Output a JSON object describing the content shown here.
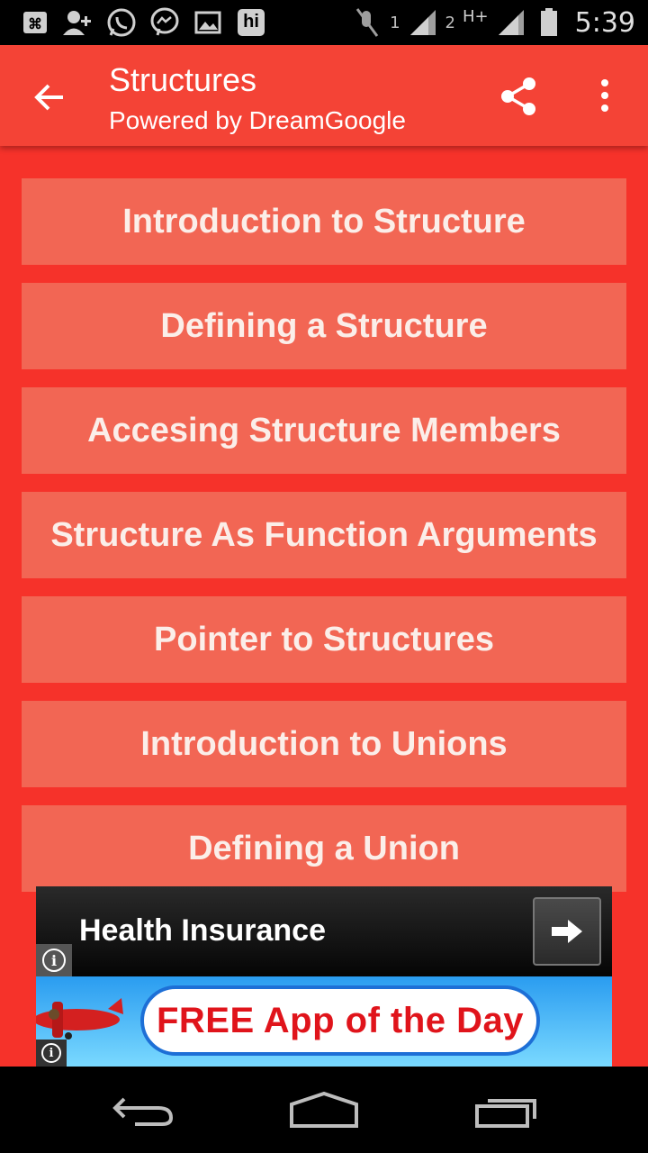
{
  "status_bar": {
    "sim1": "1",
    "sim2": "2",
    "network": "H+",
    "time": "5:39",
    "left_icons": [
      "voicemail-icon",
      "add-contact-icon",
      "whatsapp-icon",
      "messenger-icon",
      "gallery-icon",
      "hike-icon"
    ],
    "hike_label": "hi"
  },
  "app_bar": {
    "title": "Structures",
    "subtitle": "Powered by DreamGoogle",
    "color": "#f44336"
  },
  "topics": [
    {
      "label": "Introduction to Structure"
    },
    {
      "label": "Defining a Structure"
    },
    {
      "label": "Accesing Structure Members"
    },
    {
      "label": "Structure As Function Arguments"
    },
    {
      "label": "Pointer to Structures"
    },
    {
      "label": "Introduction to Unions"
    },
    {
      "label": "Defining a Union"
    }
  ],
  "ad": {
    "headline": "Health Insurance",
    "cta": "FREE App of the Day",
    "info_glyph": "i"
  },
  "colors": {
    "background": "#f6322a",
    "item": "#f26654",
    "item_text": "#fbeee9"
  }
}
